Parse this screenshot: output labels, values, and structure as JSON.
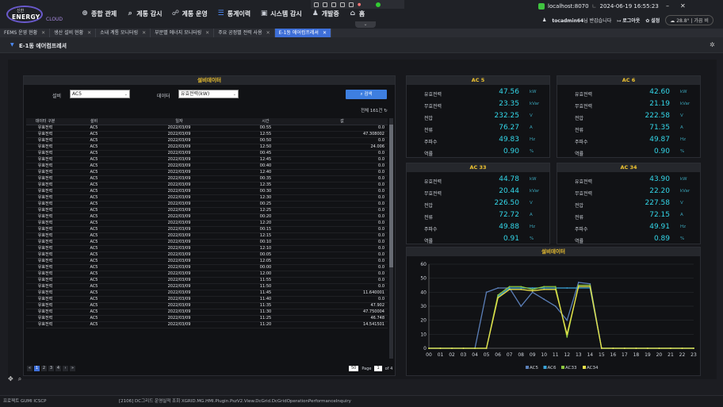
{
  "app": {
    "logo_small": "신한",
    "logo_big": "ENERGY",
    "logo_cloud": "CLOUD"
  },
  "nav": [
    {
      "label": "종합 관제",
      "icon": "monitor-icon"
    },
    {
      "label": "계통 감시",
      "icon": "search-icon"
    },
    {
      "label": "계통 운영",
      "icon": "network-icon"
    },
    {
      "label": "통계이력",
      "icon": "list-icon"
    },
    {
      "label": "시스템 감시",
      "icon": "system-monitor-icon"
    },
    {
      "label": "개발중",
      "icon": "person-icon"
    },
    {
      "label": "홈",
      "icon": "home-icon"
    }
  ],
  "server": {
    "host": "localhost:8070",
    "datetime": "2024-06-19 16:55:23"
  },
  "user": {
    "name": "tocadmin64",
    "greeting": "님 반갑습니다",
    "logout": "로그아웃",
    "settings": "설정",
    "weather": "28.8° | 가끔 비"
  },
  "tabs": [
    {
      "label": "FEMS 운영 현황",
      "active": false
    },
    {
      "label": "생산 설비 현황",
      "active": false
    },
    {
      "label": "소내 계통 모니터링",
      "active": false
    },
    {
      "label": "부문별 에너지 모니터링",
      "active": false
    },
    {
      "label": "주요 공정별 전력 사용",
      "active": false
    },
    {
      "label": "E-1동 에어컴프레셔",
      "active": true
    }
  ],
  "page": {
    "title": "E-1동 에어컴프레셔"
  },
  "left": {
    "header": "설비데이터",
    "equip_label": "설비",
    "equip_value": "AC5",
    "data_label": "데이터",
    "data_value": "유효전력(kW)",
    "search": "검색",
    "total": "전체 161건",
    "columns": [
      "데이터 구분",
      "설비",
      "일자",
      "시간",
      "값"
    ],
    "rows": [
      [
        "유효전력",
        "AC5",
        "2022/03/09",
        "00:55",
        "0.0"
      ],
      [
        "유효전력",
        "AC5",
        "2022/03/09",
        "12:55",
        "47.308002"
      ],
      [
        "유효전력",
        "AC5",
        "2022/03/09",
        "00:50",
        "0.0"
      ],
      [
        "유효전력",
        "AC5",
        "2022/03/09",
        "12:50",
        "24.006"
      ],
      [
        "유효전력",
        "AC5",
        "2022/03/09",
        "00:45",
        "0.0"
      ],
      [
        "유효전력",
        "AC5",
        "2022/03/09",
        "12:45",
        "0.0"
      ],
      [
        "유효전력",
        "AC5",
        "2022/03/09",
        "00:40",
        "0.0"
      ],
      [
        "유효전력",
        "AC5",
        "2022/03/09",
        "12:40",
        "0.0"
      ],
      [
        "유효전력",
        "AC5",
        "2022/03/09",
        "00:35",
        "0.0"
      ],
      [
        "유효전력",
        "AC5",
        "2022/03/09",
        "12:35",
        "0.0"
      ],
      [
        "유효전력",
        "AC5",
        "2022/03/09",
        "00:30",
        "0.0"
      ],
      [
        "유효전력",
        "AC5",
        "2022/03/09",
        "12:30",
        "0.0"
      ],
      [
        "유효전력",
        "AC5",
        "2022/03/09",
        "00:25",
        "0.0"
      ],
      [
        "유효전력",
        "AC5",
        "2022/03/09",
        "12:25",
        "0.0"
      ],
      [
        "유효전력",
        "AC5",
        "2022/03/09",
        "00:20",
        "0.0"
      ],
      [
        "유효전력",
        "AC5",
        "2022/03/09",
        "12:20",
        "0.0"
      ],
      [
        "유효전력",
        "AC5",
        "2022/03/09",
        "00:15",
        "0.0"
      ],
      [
        "유효전력",
        "AC5",
        "2022/03/09",
        "12:15",
        "0.0"
      ],
      [
        "유효전력",
        "AC5",
        "2022/03/09",
        "00:10",
        "0.0"
      ],
      [
        "유효전력",
        "AC5",
        "2022/03/09",
        "12:10",
        "0.0"
      ],
      [
        "유효전력",
        "AC5",
        "2022/03/09",
        "00:05",
        "0.0"
      ],
      [
        "유효전력",
        "AC5",
        "2022/03/09",
        "12:05",
        "0.0"
      ],
      [
        "유효전력",
        "AC5",
        "2022/03/09",
        "00:00",
        "0.0"
      ],
      [
        "유효전력",
        "AC5",
        "2022/03/09",
        "12:00",
        "0.0"
      ],
      [
        "유효전력",
        "AC5",
        "2022/03/09",
        "11:55",
        "0.0"
      ],
      [
        "유효전력",
        "AC5",
        "2022/03/09",
        "11:50",
        "0.0"
      ],
      [
        "유효전력",
        "AC5",
        "2022/03/09",
        "11:45",
        "11.640001"
      ],
      [
        "유효전력",
        "AC5",
        "2022/03/09",
        "11:40",
        "0.0"
      ],
      [
        "유효전력",
        "AC5",
        "2022/03/09",
        "11:35",
        "47.902"
      ],
      [
        "유효전력",
        "AC5",
        "2022/03/09",
        "11:30",
        "47.750004"
      ],
      [
        "유효전력",
        "AC5",
        "2022/03/09",
        "11:25",
        "46.748"
      ],
      [
        "유효전력",
        "AC5",
        "2022/03/09",
        "11:20",
        "14.541501"
      ]
    ],
    "pages": [
      "1",
      "2",
      "3",
      "4"
    ],
    "page_size": "50",
    "page_label": "Page",
    "page_current": "1",
    "page_total": "of 4"
  },
  "ac_units": [
    {
      "name": "AC 5",
      "rows": [
        [
          "유효전력",
          "47.56",
          "kW"
        ],
        [
          "무효전력",
          "23.35",
          "kVar"
        ],
        [
          "전압",
          "232.25",
          "V"
        ],
        [
          "전류",
          "76.27",
          "A"
        ],
        [
          "주파수",
          "49.83",
          "Hz"
        ],
        [
          "역률",
          "0.90",
          "%"
        ]
      ]
    },
    {
      "name": "AC 6",
      "rows": [
        [
          "유효전력",
          "42.60",
          "kW"
        ],
        [
          "무효전력",
          "21.19",
          "kVar"
        ],
        [
          "전압",
          "222.58",
          "V"
        ],
        [
          "전류",
          "71.35",
          "A"
        ],
        [
          "주파수",
          "49.87",
          "Hz"
        ],
        [
          "역률",
          "0.90",
          "%"
        ]
      ]
    },
    {
      "name": "AC 33",
      "rows": [
        [
          "유효전력",
          "44.78",
          "kW"
        ],
        [
          "무효전력",
          "20.44",
          "kVar"
        ],
        [
          "전압",
          "226.50",
          "V"
        ],
        [
          "전류",
          "72.72",
          "A"
        ],
        [
          "주파수",
          "49.88",
          "Hz"
        ],
        [
          "역률",
          "0.91",
          "%"
        ]
      ]
    },
    {
      "name": "AC 34",
      "rows": [
        [
          "유효전력",
          "43.90",
          "kW"
        ],
        [
          "무효전력",
          "22.20",
          "kVar"
        ],
        [
          "전압",
          "227.58",
          "V"
        ],
        [
          "전류",
          "72.15",
          "A"
        ],
        [
          "주파수",
          "49.91",
          "Hz"
        ],
        [
          "역률",
          "0.89",
          "%"
        ]
      ]
    }
  ],
  "chart_title": "설비데이터",
  "chart_data": {
    "type": "line",
    "title": "설비데이터",
    "x": [
      "00",
      "01",
      "02",
      "03",
      "04",
      "05",
      "06",
      "07",
      "08",
      "09",
      "10",
      "11",
      "12",
      "13",
      "14",
      "15",
      "16",
      "17",
      "18",
      "19",
      "20",
      "21",
      "22",
      "23"
    ],
    "ylim": [
      0,
      60
    ],
    "yticks": [
      0,
      10,
      20,
      30,
      40,
      50,
      60
    ],
    "legend": "bottom",
    "series": [
      {
        "name": "AC5",
        "color": "#5b7fb8",
        "values": [
          0,
          0,
          0,
          0,
          0,
          40,
          43,
          43,
          30,
          40,
          35,
          30,
          20,
          47,
          46,
          0,
          0,
          0,
          0,
          0,
          0,
          0,
          0,
          0
        ]
      },
      {
        "name": "AC6",
        "color": "#3aa3d8",
        "values": [
          0,
          0,
          0,
          0,
          0,
          0,
          37,
          43,
          43,
          43,
          43,
          43,
          43,
          43,
          43,
          0,
          0,
          0,
          0,
          0,
          0,
          0,
          0,
          0
        ]
      },
      {
        "name": "AC33",
        "color": "#8dc63f",
        "values": [
          0,
          0,
          0,
          0,
          0,
          0,
          38,
          44,
          44,
          42,
          44,
          44,
          8,
          45,
          45,
          0,
          0,
          0,
          0,
          0,
          0,
          0,
          0,
          0
        ]
      },
      {
        "name": "AC34",
        "color": "#e8e04a",
        "values": [
          0,
          0,
          0,
          0,
          0,
          0,
          36,
          42,
          42,
          41,
          42,
          42,
          10,
          44,
          44,
          0,
          0,
          0,
          0,
          0,
          0,
          0,
          0,
          0
        ]
      }
    ]
  },
  "status": {
    "left": "프로젝트 GUMI ICSCP",
    "mid": "[2106] DC그리드 운영실적 조회 XGRID.MG.HMI.Plugin.PszV2.View.DcGrid.DcGridOperationPerformanceInquiry"
  }
}
